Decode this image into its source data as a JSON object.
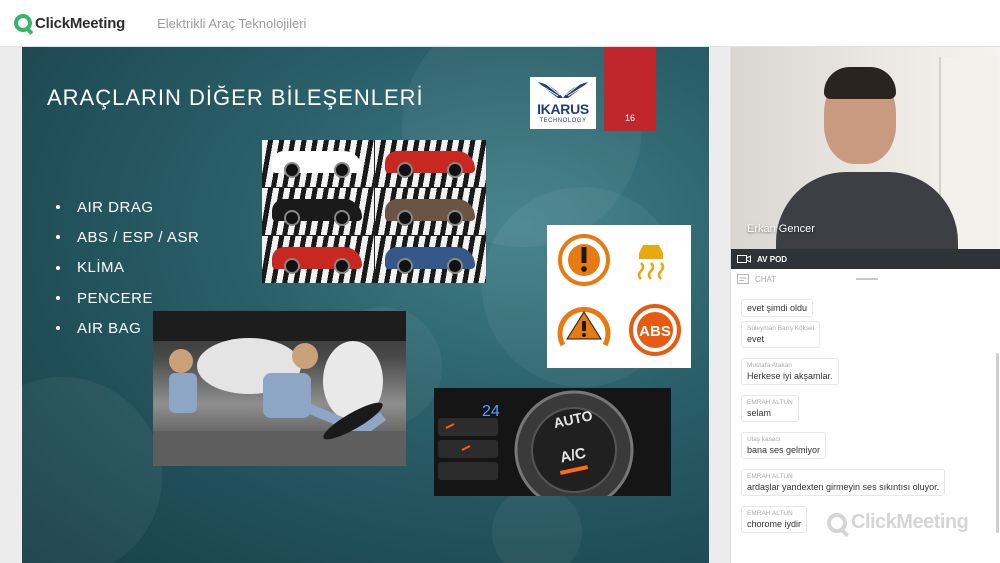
{
  "app": {
    "brand": "ClickMeeting",
    "event_title": "Elektrikli Araç Teknolojileri"
  },
  "slide": {
    "title": "ARAÇLARIN DİĞER BİLEŞENLERİ",
    "page_number": "16",
    "logo": {
      "name": "IKARUS",
      "subtitle": "TECHNOLOGY"
    },
    "bullets": [
      "AIR DRAG",
      "ABS / ESP / ASR",
      "KLİMA",
      "PENCERE",
      "AIR BAG"
    ],
    "warning_icons": [
      "brake-warning-icon",
      "stability-control-icon",
      "tire-pressure-warning-icon",
      "abs-warning-icon"
    ],
    "abs_text": "ABS",
    "climate_labels": {
      "auto": "AUTO",
      "ac": "A/C",
      "temp": "24"
    },
    "car_colors": [
      "#ffffff",
      "#c8281f",
      "#1a1a1a",
      "#6b5443",
      "#c8281f",
      "#355789"
    ]
  },
  "video": {
    "presenter_name": "Erkan Gencer",
    "stream_label": "AV POD"
  },
  "chat": {
    "header": "CHAT",
    "messages": [
      {
        "author": "",
        "text": "evet şimdi oldu"
      },
      {
        "author": "Süleyman Barış Köksel",
        "text": "evet"
      },
      {
        "author": "Mustafa Atakan",
        "text": "Herkese iyi akşamlar."
      },
      {
        "author": "EMRAH ALTUN",
        "text": "selam"
      },
      {
        "author": "Ulaş kasacı",
        "text": "bana ses gelmiyor"
      },
      {
        "author": "EMRAH ALTUN",
        "text": "ardaşlar yandexten girmeyin ses sıkıntısı oluyor."
      },
      {
        "author": "EMRAH ALTUN",
        "text": "chorome iydir"
      }
    ],
    "watermark": "ClickMeeting"
  },
  "colors": {
    "brand_green": "#3bb36d",
    "slide_accent": "#c0262c"
  }
}
